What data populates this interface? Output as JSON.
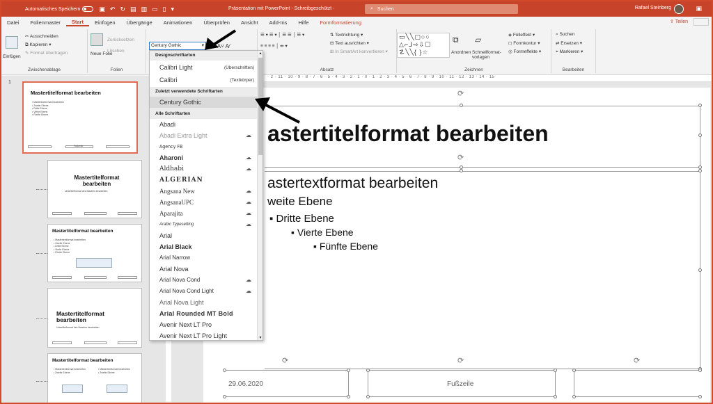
{
  "titlebar": {
    "autosave_label": "Automatisches Speichern",
    "window_title": "Präsentation mit PowerPoint - Schreibgeschützt ·",
    "search_placeholder": "Suchen",
    "user_name": "Rafael Steinberg"
  },
  "tabs": [
    "Datei",
    "Folienmaster",
    "Start",
    "Einfügen",
    "Übergänge",
    "Animationen",
    "Überprüfen",
    "Ansicht",
    "Add-Ins",
    "Hilfe",
    "Formformatierung"
  ],
  "active_tab": "Start",
  "share_label": "Teilen",
  "ribbon": {
    "clipboard": {
      "label": "Zwischenablage",
      "paste": "Einfügen",
      "cut": "Ausschneiden",
      "copy": "Kopieren",
      "format_painter": "Format übertragen"
    },
    "slides": {
      "label": "Folien",
      "new_slide": "Neue Folie",
      "reset": "Zurücksetzen",
      "delete": "Löschen"
    },
    "font": {
      "current": "Century Gothic"
    },
    "paragraph": {
      "label": "Absatz",
      "text_direction": "Textrichtung",
      "align_text": "Text ausrichten",
      "smartart": "In SmartArt konvertieren"
    },
    "drawing": {
      "label": "Zeichnen",
      "arrange": "Anordnen",
      "quick_styles": "Schnellformat-vorlagen",
      "fill": "Fülleffekt",
      "outline": "Formkontur",
      "effects": "Formeffekte"
    },
    "editing": {
      "label": "Bearbeiten",
      "find": "Suchen",
      "replace": "Ersetzen",
      "select": "Markieren"
    }
  },
  "ruler_text": "· 2 · 11 · 10 · 9 · 8 · 7 · 6 · 5 · 4 · 3 · 2 · 1 · 0 · 1 · 2 · 3 · 4 · 5 · 6 · 7 · 8 · 9 · 10 · 11 · 12 · 13 · 14 · 15",
  "font_dropdown": {
    "section_theme": "Designschriftarten",
    "theme_fonts": [
      {
        "name": "Calibri Light",
        "tag": "(Überschriften)"
      },
      {
        "name": "Calibri",
        "tag": "(Textkörper)"
      }
    ],
    "section_recent": "Zuletzt verwendete Schriftarten",
    "recent_fonts": [
      "Century Gothic"
    ],
    "section_all": "Alle Schriftarten",
    "all_fonts": [
      {
        "name": "Abadi",
        "cloud": false
      },
      {
        "name": "Abadi Extra Light",
        "cloud": true
      },
      {
        "name": "Agency FB",
        "cloud": false
      },
      {
        "name": "Aharoni",
        "cloud": true
      },
      {
        "name": "Aldhabi",
        "cloud": true
      },
      {
        "name": "ALGERIAN",
        "cloud": false
      },
      {
        "name": "Angsana New",
        "cloud": true
      },
      {
        "name": "AngsanaUPC",
        "cloud": true
      },
      {
        "name": "Aparajita",
        "cloud": true
      },
      {
        "name": "Arabic Typesetting",
        "cloud": true
      },
      {
        "name": "Arial",
        "cloud": false
      },
      {
        "name": "Arial Black",
        "cloud": false
      },
      {
        "name": "Arial Narrow",
        "cloud": false
      },
      {
        "name": "Arial Nova",
        "cloud": false
      },
      {
        "name": "Arial Nova Cond",
        "cloud": true
      },
      {
        "name": "Arial Nova Cond Light",
        "cloud": true
      },
      {
        "name": "Arial Nova Light",
        "cloud": false
      },
      {
        "name": "Arial Rounded MT Bold",
        "cloud": false
      },
      {
        "name": "Avenir Next LT Pro",
        "cloud": false
      },
      {
        "name": "Avenir Next LT Pro Light",
        "cloud": false
      }
    ]
  },
  "thumbnails": [
    {
      "num": "1",
      "title": "Mastertitelformat bearbeiten",
      "lines": [
        "• Mastertextformat bearbeiten",
        "   • Zweite Ebene",
        "      • Dritte Ebene",
        "         • Vierte Ebene",
        "            • Fünfte Ebene"
      ],
      "footer_mid": "Fußzeile"
    },
    {
      "title": "Mastertitelformat bearbeiten",
      "sub": "Untertitelformat des Masters bearbeiten"
    },
    {
      "title": "Mastertitelformat bearbeiten",
      "lines": [
        "• Mastertextformat bearbeiten",
        "   • Zweite Ebene",
        "      • Dritte Ebene",
        "         • Vierte Ebene",
        "            • Fünfte Ebene"
      ]
    },
    {
      "title": "Mastertitelformat bearbeiten",
      "sub": "Untertitelformat des Masters bearbeiten"
    },
    {
      "title": "Mastertitelformat bearbeiten",
      "lines": [
        "• Mastertextformat bearbeiten",
        "   • Zweite Ebene"
      ]
    }
  ],
  "slide": {
    "title": "astertitelformat bearbeiten",
    "level1": "astertextformat bearbeiten",
    "level2": "weite Ebene",
    "level3": "Dritte Ebene",
    "level4": "Vierte Ebene",
    "level5": "Fünfte Ebene",
    "date": "29.06.2020",
    "footer": "Fußzeile"
  }
}
